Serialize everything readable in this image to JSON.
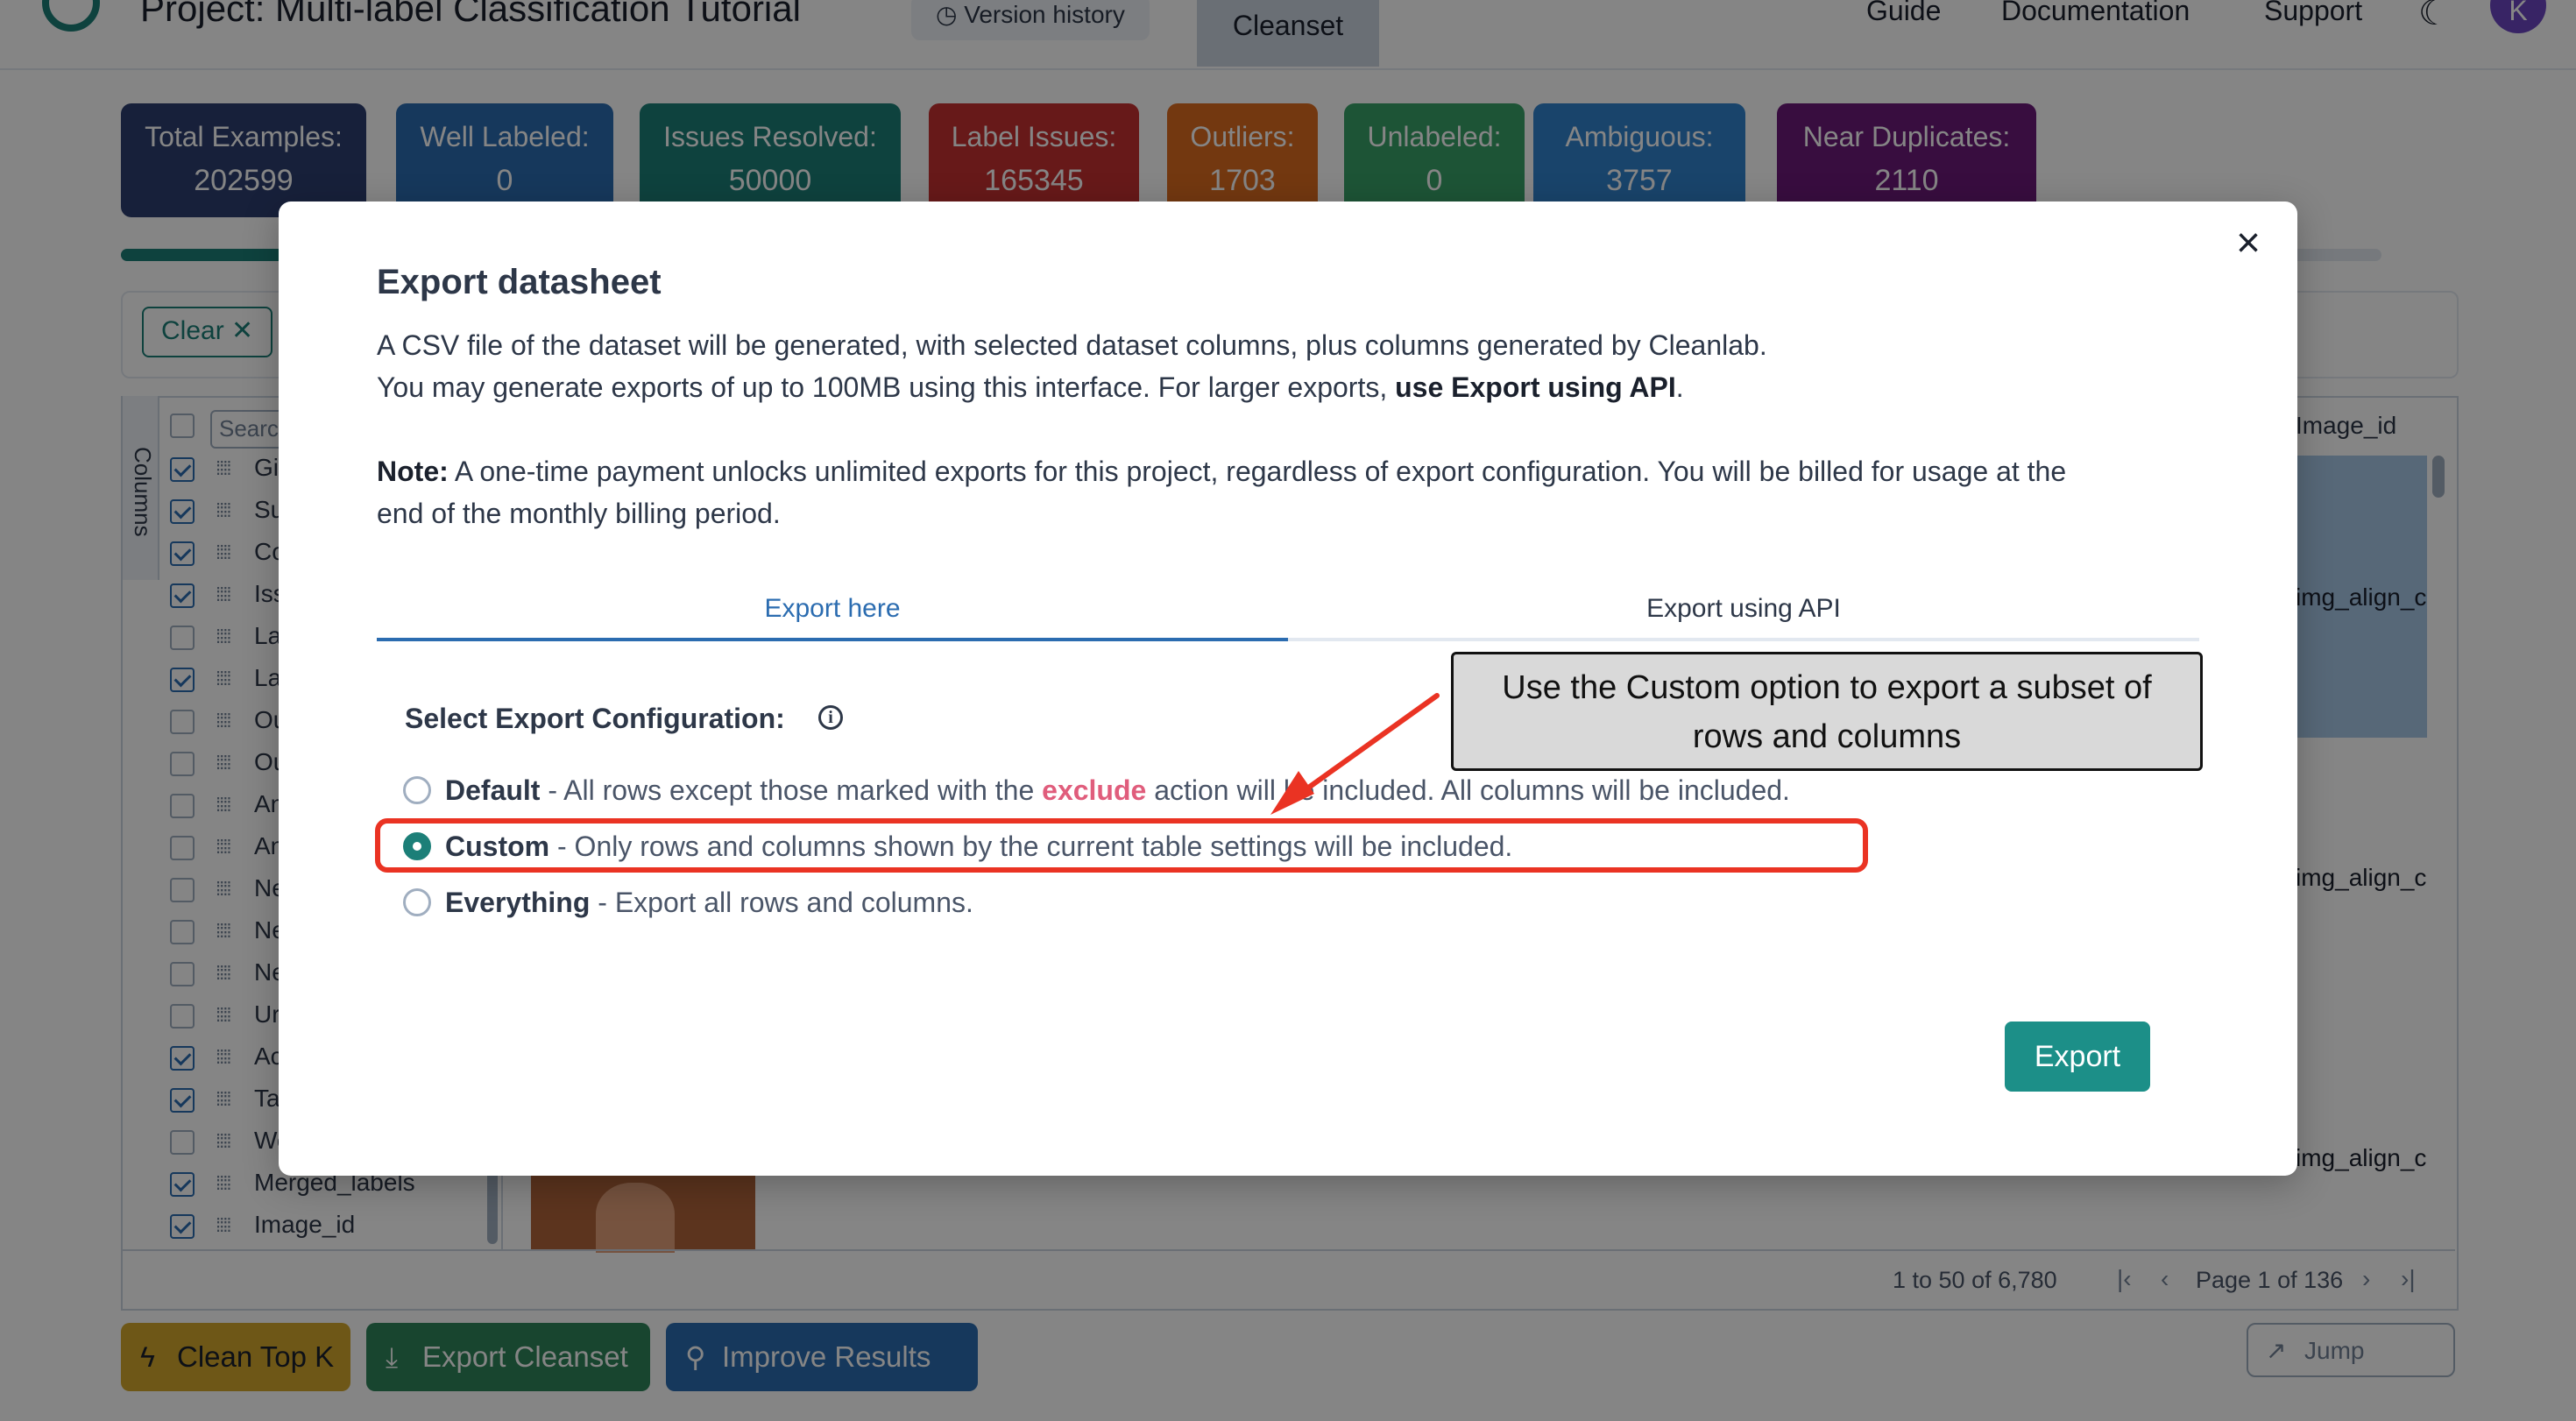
{
  "app": {
    "project_title": "Project: Multi-label Classification Tutorial",
    "version_history": "Version history",
    "active_tab": "Cleanset",
    "nav": [
      "Guide",
      "Documentation",
      "Support"
    ],
    "avatar_initial": "K"
  },
  "stats": [
    {
      "label": "Total Examples:",
      "value": "202599",
      "color": "#2c3e70"
    },
    {
      "label": "Well Labeled:",
      "value": "0",
      "color": "#2b6cb0"
    },
    {
      "label": "Issues Resolved:",
      "value": "50000",
      "color": "#1c7f78"
    },
    {
      "label": "Label Issues:",
      "value": "165345",
      "color": "#c53030"
    },
    {
      "label": "Outliers:",
      "value": "1703",
      "color": "#dd6b20"
    },
    {
      "label": "Unlabeled:",
      "value": "0",
      "color": "#38a169"
    },
    {
      "label": "Ambiguous:",
      "value": "3757",
      "color": "#3182ce"
    },
    {
      "label": "Near Duplicates:",
      "value": "2110",
      "color": "#6b1a7a"
    }
  ],
  "filters": {
    "clear_label": "Clear ✕"
  },
  "columns_panel": {
    "tab_label": "Columns",
    "search_placeholder": "Search...",
    "items": [
      {
        "label": "Gi",
        "checked": true
      },
      {
        "label": "Su",
        "checked": true
      },
      {
        "label": "Co",
        "checked": true
      },
      {
        "label": "Iss",
        "checked": true
      },
      {
        "label": "La",
        "checked": false
      },
      {
        "label": "La",
        "checked": true
      },
      {
        "label": "Ou",
        "checked": false
      },
      {
        "label": "Ou",
        "checked": false
      },
      {
        "label": "An",
        "checked": false
      },
      {
        "label": "An",
        "checked": false
      },
      {
        "label": "Ne",
        "checked": false
      },
      {
        "label": "Ne",
        "checked": false
      },
      {
        "label": "Ne",
        "checked": false
      },
      {
        "label": "Ur",
        "checked": false
      },
      {
        "label": "Ac",
        "checked": true
      },
      {
        "label": "Ta",
        "checked": true
      },
      {
        "label": "We",
        "checked": false
      },
      {
        "label": "Merged_labels",
        "checked": true
      },
      {
        "label": "Image_id",
        "checked": true
      }
    ]
  },
  "grid": {
    "image_id_header": "Image_id",
    "image_id_cells": [
      "img_align_c",
      "img_align_c",
      "img_align_c"
    ],
    "row_count": "1 to 50 of 6,780",
    "page": "Page 1 of 136"
  },
  "actions": {
    "clean_top_k": "Clean Top K",
    "export_cleanset": "Export Cleanset",
    "improve_results": "Improve Results",
    "jump_placeholder": "Jump"
  },
  "modal": {
    "title": "Export datasheet",
    "line1": "A CSV file of the dataset will be generated, with selected dataset columns, plus columns generated by Cleanlab.",
    "line2_prefix": "You may generate exports of up to 100MB using this interface. For larger exports, ",
    "line2_link": "use Export using API",
    "line2_suffix": ".",
    "note_label": "Note:",
    "note_text": " A one-time payment unlocks unlimited exports for this project, regardless of export configuration. You will be billed for usage at the",
    "note_text2": "end of the monthly billing period.",
    "tabs": [
      "Export here",
      "Export using API"
    ],
    "config_label": "Select Export Configuration:",
    "options": [
      {
        "name": "Default",
        "desc_before": " - All rows except those marked with the ",
        "keyword": "exclude",
        "desc_after": " action will be included. All columns will be included.",
        "selected": false
      },
      {
        "name": "Custom",
        "desc": " - Only rows and columns shown by the current table settings will be included.",
        "selected": true
      },
      {
        "name": "Everything",
        "desc": " - Export all rows and columns.",
        "selected": false
      }
    ],
    "export_button": "Export"
  },
  "annotation": {
    "callout_line1": "Use the Custom option to export a subset of",
    "callout_line2": "rows and columns",
    "highlight_color": "#ea3323"
  },
  "colors": {
    "brand_teal": "#1c7f78",
    "link_blue": "#2b6cb0",
    "export_button": "#1c8f88"
  }
}
